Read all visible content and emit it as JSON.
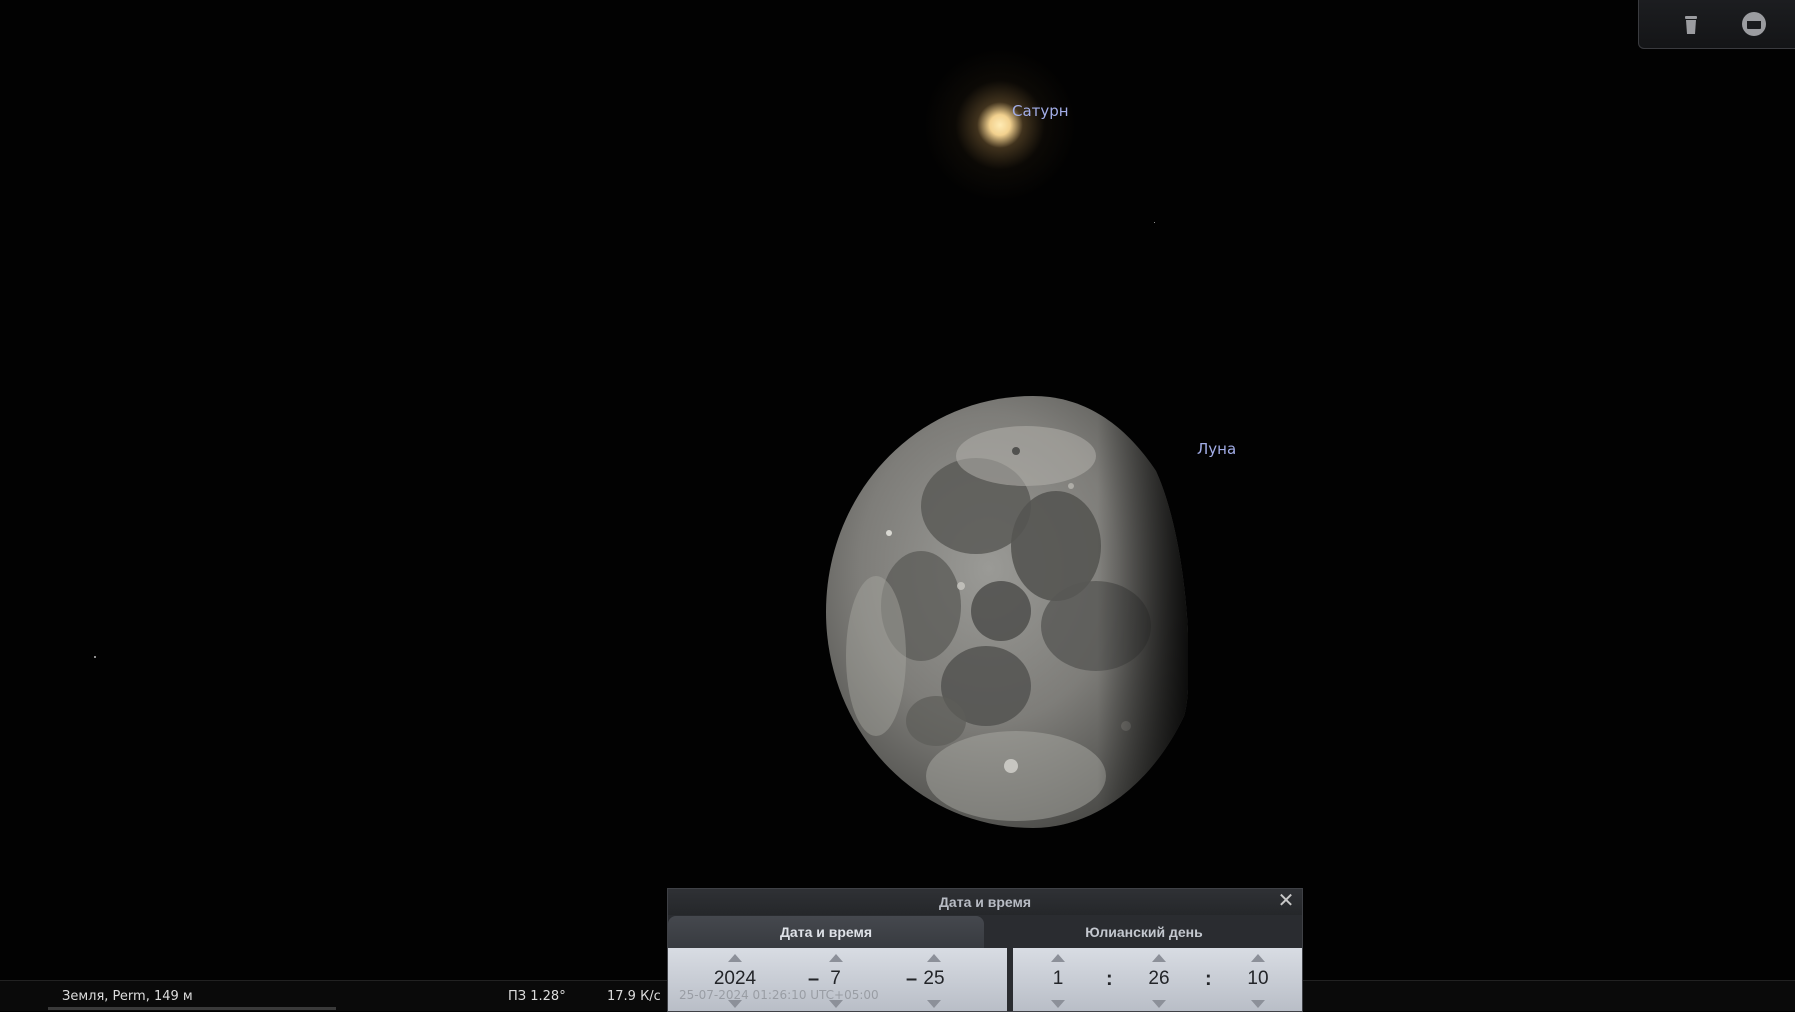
{
  "sky": {
    "saturn_label": "Сатурн",
    "moon_label": "Луна"
  },
  "topbar": {
    "buttons": [
      {
        "name": "trash-icon"
      },
      {
        "name": "window-icon"
      }
    ]
  },
  "statusbar": {
    "location": "Земля, Perm, 149 м",
    "fov": "ПЗ 1.28°",
    "fps": "17.9 К/с",
    "datetime": "25-07-2024 01:26:10 UTC+05:00"
  },
  "dialog": {
    "title": "Дата и время",
    "tabs": [
      {
        "label": "Дата и время",
        "active": true
      },
      {
        "label": "Юлианский день",
        "active": false
      }
    ],
    "date": {
      "year": "2024",
      "month": "7",
      "day": "25",
      "separator": "–"
    },
    "time": {
      "hour": "1",
      "minute": "26",
      "second": "10",
      "separator": ":"
    }
  },
  "colors": {
    "label": "#a3aee8",
    "background": "#020202"
  }
}
